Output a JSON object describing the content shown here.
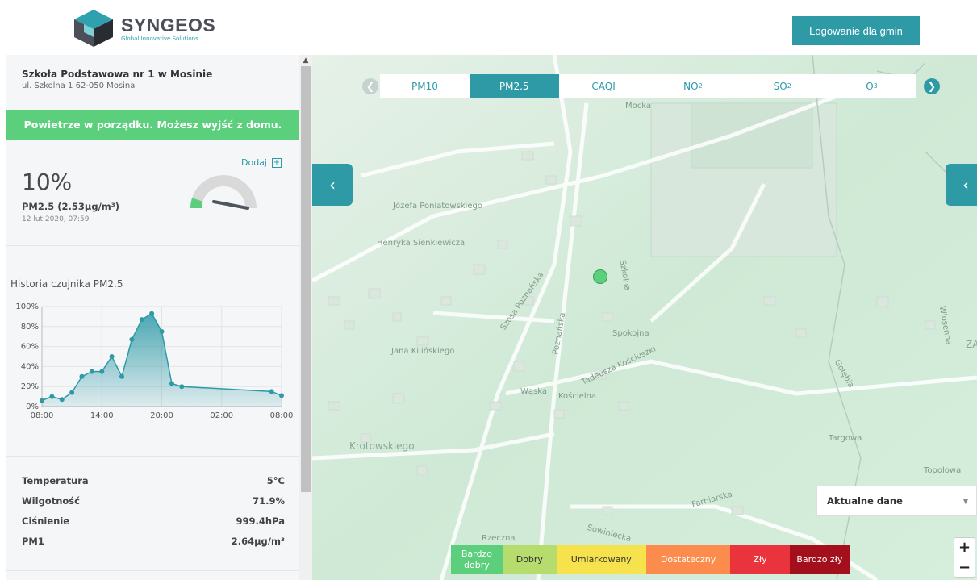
{
  "header": {
    "brand_name": "SYNGEOS",
    "brand_tagline": "Global Innovative Solutions",
    "login_button": "Logowanie dla gmin"
  },
  "station": {
    "name": "Szkoła Podstawowa nr 1 w Mosinie",
    "address": "ul. Szkolna 1 62-050 Mosina",
    "status_text": "Powietrze w porządku. Możesz wyjść z domu.",
    "add_label": "Dodaj",
    "percent": "10%",
    "reading": "PM2.5 (2.53µg/m³)",
    "timestamp": "12 lut 2020, 07:59",
    "gauge_fraction": 0.1
  },
  "history": {
    "title": "Historia czujnika PM2.5"
  },
  "chart_data": {
    "type": "area",
    "title": "Historia czujnika PM2.5",
    "ytick_labels": [
      "0%",
      "20%",
      "40%",
      "60%",
      "80%",
      "100%"
    ],
    "xtick_labels": [
      "08:00",
      "14:00",
      "20:00",
      "02:00",
      "08:00"
    ],
    "ylim": [
      0,
      100
    ],
    "xlim_hours": [
      0,
      24
    ],
    "grid": true,
    "series": [
      {
        "color": "#2d9aa6",
        "x": [
          0,
          1,
          2,
          3,
          4,
          5,
          6,
          7,
          8,
          9,
          10,
          11,
          12,
          13,
          14,
          23,
          24
        ],
        "values": [
          6,
          10,
          7,
          14,
          30,
          35,
          35,
          50,
          30,
          67,
          87,
          93,
          75,
          23,
          20,
          15,
          11
        ]
      }
    ]
  },
  "stats": [
    {
      "label": "Temperatura",
      "value": "5°C"
    },
    {
      "label": "Wilgotność",
      "value": "71.9%"
    },
    {
      "label": "Ciśnienie",
      "value": "999.4hPa"
    },
    {
      "label": "PM1",
      "value": "2.64µg/m³"
    }
  ],
  "tabs": [
    {
      "label": "PM10",
      "sub": "",
      "active": false
    },
    {
      "label": "PM2.5",
      "sub": "",
      "active": true
    },
    {
      "label": "CAQI",
      "sub": "",
      "active": false
    },
    {
      "label": "NO",
      "sub": "2",
      "active": false
    },
    {
      "label": "SO",
      "sub": "2",
      "active": false
    },
    {
      "label": "O",
      "sub": "3",
      "active": false
    }
  ],
  "dataset_select": {
    "value": "Aktualne dane"
  },
  "zoom": {
    "in": "+",
    "out": "−"
  },
  "legend": [
    {
      "label": "Bardzo dobry",
      "color": "#5ccf7d",
      "text_color": "#ffffff"
    },
    {
      "label": "Dobry",
      "color": "#b7dc6e",
      "text_color": "#333333"
    },
    {
      "label": "Umiarkowany",
      "color": "#f5e24d",
      "text_color": "#333333"
    },
    {
      "label": "Dostateczny",
      "color": "#fb8c4d",
      "text_color": "#ffffff"
    },
    {
      "label": "Zły",
      "color": "#e9333d",
      "text_color": "#ffffff"
    },
    {
      "label": "Bardzo zły",
      "color": "#a3101c",
      "text_color": "#ffffff"
    }
  ],
  "map_labels": [
    "Mocka",
    "Józefa Poniatowskiego",
    "Henryka Sienkiewicza",
    "Szosa Poznańska",
    "Poznańska",
    "Szkolna",
    "Spokojna",
    "Jana Kilińskiego",
    "Tadeusza Kościuszki",
    "Wąska",
    "Kościelna",
    "Krotowskiego",
    "Gołębia",
    "Farbiarska",
    "Sowiniecka",
    "Rzeczna",
    "Wiosenna",
    "Targowa",
    "Topolowa",
    "ZA"
  ]
}
